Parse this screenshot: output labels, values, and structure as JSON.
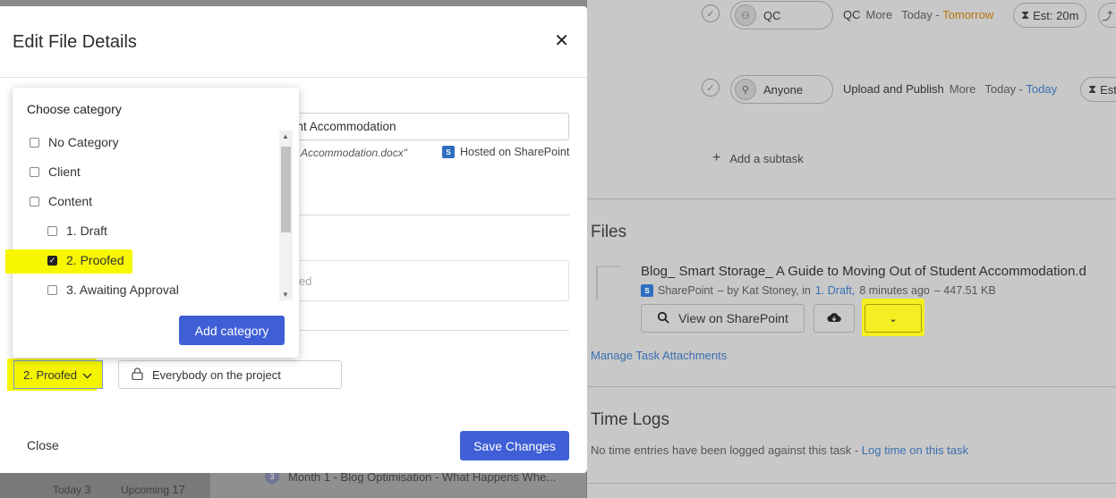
{
  "background": {
    "tasks": [
      {
        "assignee": "QC",
        "title": "QC",
        "more": "More",
        "date_prefix": "Today - ",
        "due": "Tomorrow",
        "estimate": "Est: 20m"
      },
      {
        "assignee": "Anyone",
        "title": "Upload and Publish",
        "more": "More",
        "date_prefix": "Today - ",
        "due": "Today",
        "estimate": "Est"
      }
    ],
    "add_subtask": "Add a subtask",
    "files_title": "Files",
    "file": {
      "name": "Blog_ Smart Storage_ A Guide to Moving Out of Student Accommodation.d",
      "source": "SharePoint",
      "by": "–  by Kat Stoney,  in",
      "category": "1. Draft,",
      "age": "8 minutes ago",
      "size": "–  447.51 KB",
      "view_button": "View on SharePoint"
    },
    "manage_link": "Manage Task Attachments",
    "timelogs_title": "Time Logs",
    "no_time_text": "No time entries have been logged against this task - ",
    "log_time_link": "Log time on this task",
    "bottom_row": {
      "number": "3",
      "text": "Month 1 - Blog Optimisation - What Happens Whe..."
    },
    "bottom_tabs": [
      {
        "label": "Today",
        "count": "3"
      },
      {
        "label": "Upcoming",
        "count": "17"
      }
    ]
  },
  "modal": {
    "title": "Edit File Details",
    "name_value": "ent Accommodation",
    "file_caption": "Accommodation.docx\"",
    "hosted_label": "Hosted on SharePoint",
    "description_placeholder": "led",
    "category_selected": "2. Proofed",
    "visibility": "Everybody on the project",
    "close_label": "Close",
    "save_label": "Save Changes"
  },
  "category_popup": {
    "title": "Choose category",
    "items": [
      {
        "label": "No Category",
        "checked": false,
        "indent": 0
      },
      {
        "label": "Client",
        "checked": false,
        "indent": 0
      },
      {
        "label": "Content",
        "checked": false,
        "indent": 0
      },
      {
        "label": "1. Draft",
        "checked": false,
        "indent": 1
      },
      {
        "label": "2. Proofed",
        "checked": true,
        "indent": 1
      },
      {
        "label": "3. Awaiting Approval",
        "checked": false,
        "indent": 1
      }
    ],
    "add_button": "Add category"
  }
}
